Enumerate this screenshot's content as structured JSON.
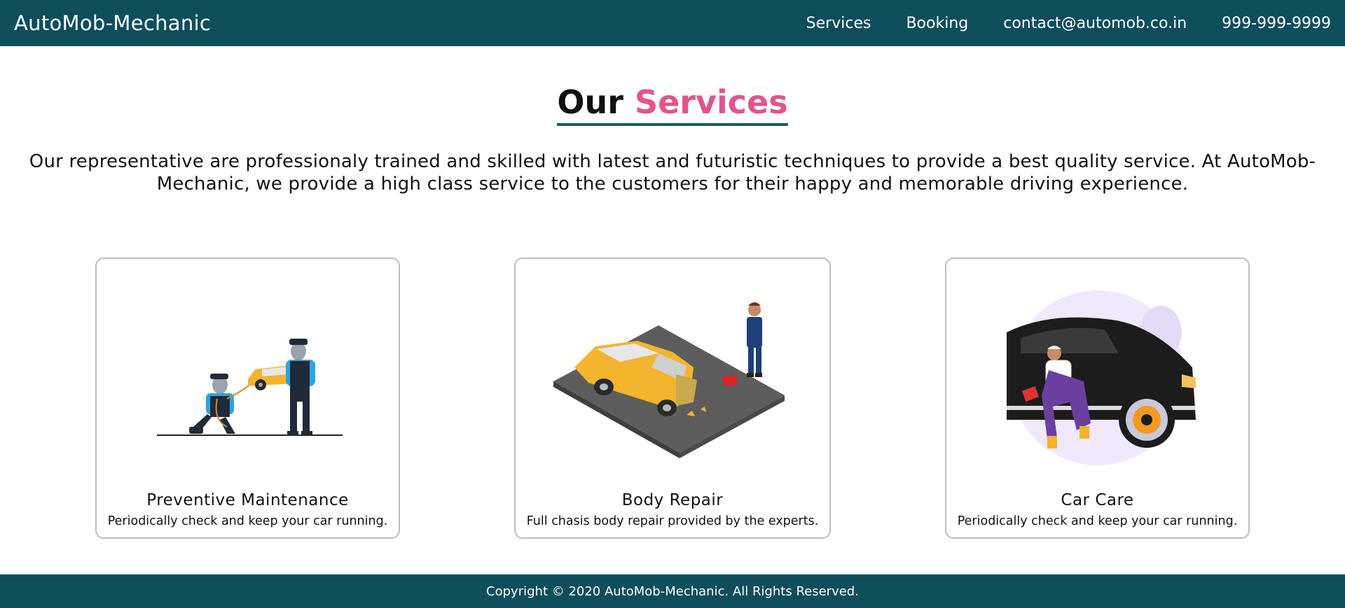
{
  "nav": {
    "brand": "AutoMob-Mechanic",
    "links": [
      "Services",
      "Booking",
      "contact@automob.co.in",
      "999-999-9999"
    ]
  },
  "section": {
    "title_plain": "Our",
    "title_accent": "Services",
    "intro": "Our representative are professionaly trained and skilled with latest and futuristic techniques to provide a best quality service. At AutoMob-Mechanic, we provide a high class service to the customers for their happy and memorable driving experience."
  },
  "services": [
    {
      "title": "Preventive Maintenance",
      "desc": "Periodically check and keep your car running.",
      "icon": "maintenance-illustration"
    },
    {
      "title": "Body Repair",
      "desc": "Full chasis body repair provided by the experts.",
      "icon": "body-repair-illustration"
    },
    {
      "title": "Car Care",
      "desc": "Periodically check and keep your car running.",
      "icon": "car-care-illustration"
    }
  ],
  "footer": {
    "copyright": "Copyright © 2020 AutoMob-Mechanic. All Rights Reserved."
  },
  "colors": {
    "nav_bg": "#0e4d5c",
    "accent": "#e0558d",
    "underline": "#1a5a6a",
    "card_border": "#bdbdbd"
  }
}
